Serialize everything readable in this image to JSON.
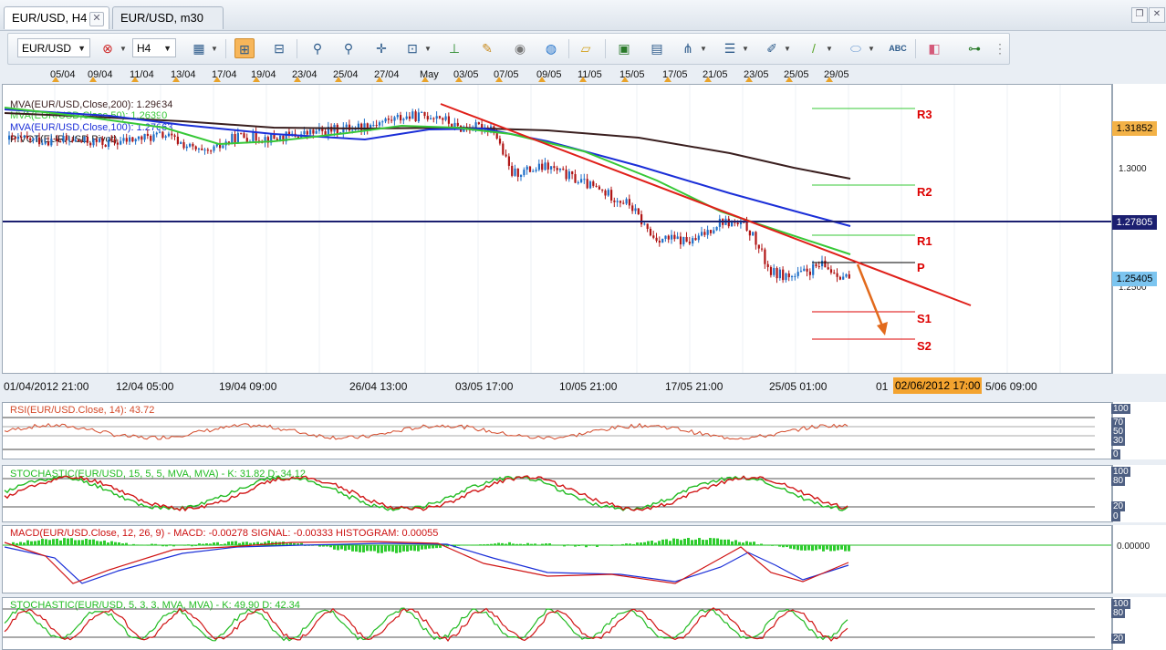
{
  "tabs": [
    {
      "label": "EUR/USD, H4",
      "active": true
    },
    {
      "label": "EUR/USD, m30",
      "active": false
    }
  ],
  "toolbar": {
    "symbol": "EUR/USD",
    "timeframe": "H4",
    "icons": [
      "symbol-remove-icon",
      "chart-type-icon",
      "bar-view-icon",
      "tape-view-icon",
      "magnifier-zoom-in-icon",
      "magnifier-zoom-out-icon",
      "crosshair-icon",
      "price-scale-icon",
      "indicator-icon",
      "edit-icon",
      "eye-icon",
      "globe-icon",
      "ruler-icon",
      "picture-icon",
      "template-icon",
      "fork-icon",
      "lines-menu-icon",
      "pencil-icon",
      "brush-icon",
      "ellipse-icon",
      "text-abc-icon",
      "eraser-icon",
      "tree-icon",
      "overflow-icon"
    ]
  },
  "top_dates": [
    "05/04",
    "09/04",
    "11/04",
    "13/04",
    "17/04",
    "19/04",
    "23/04",
    "25/04",
    "27/04",
    "May",
    "03/05",
    "07/05",
    "09/05",
    "11/05",
    "15/05",
    "17/05",
    "21/05",
    "23/05",
    "25/05",
    "29/05"
  ],
  "main_chart": {
    "legend": [
      {
        "text": "MVA(EUR/USD,Close,200): 1.29634",
        "color": "#3a1f1f"
      },
      {
        "text": "MVA(EUR/USD,Close,50): 1.26390",
        "color": "#37c837"
      },
      {
        "text": "MVA(EUR/USD,Close,100): 1.27663",
        "color": "#1b2fd8"
      },
      {
        "text": "PIVOT(EUR/USD,Pivot)",
        "color": "#222222"
      }
    ],
    "price_ticks": [
      "1.3000",
      "1.2500"
    ],
    "price_boxes": [
      {
        "value": "1.31852",
        "bg": "#f3b247"
      },
      {
        "value": "1.27805",
        "bg": "#1b1f70"
      },
      {
        "value": "1.25405",
        "bg": "#7cc5f0"
      }
    ],
    "pivot_labels": [
      "R3",
      "R2",
      "R1",
      "P",
      "S1",
      "S2"
    ],
    "horizontal_level": 1.27805
  },
  "bottom_dates": [
    "01/04/2012 21:00",
    "12/04 05:00",
    "19/04 09:00",
    "26/04 13:00",
    "03/05 17:00",
    "10/05 21:00",
    "17/05 21:00",
    "25/05 01:00",
    "01",
    "5/06 09:00"
  ],
  "cursor_date": "02/06/2012 17:00",
  "indicators": [
    {
      "title": "RSI(EUR/USD.Close, 14): 43.72",
      "color": "#d44a2a",
      "levels": [
        "100",
        "70",
        "50",
        "30",
        "0"
      ]
    },
    {
      "title": "STOCHASTIC(EUR/USD, 15, 5, 5, MVA, MVA) -  K: 31.82  D: 34.12",
      "color": "#22bb22",
      "levels": [
        "100",
        "80",
        "20",
        "0"
      ]
    },
    {
      "title": "MACD(EUR/USD.Close, 12, 26, 9) -  MACD: -0.00278  SIGNAL: -0.00333  HISTOGRAM: 0.00055",
      "color": "#cc1111",
      "levels": [
        "0.00000"
      ]
    },
    {
      "title": "STOCHASTIC(EUR/USD, 5, 3, 3, MVA, MVA) -  K: 49.90  D: 42.34",
      "color": "#22bb22",
      "levels": [
        "100",
        "80",
        "20"
      ]
    }
  ]
}
